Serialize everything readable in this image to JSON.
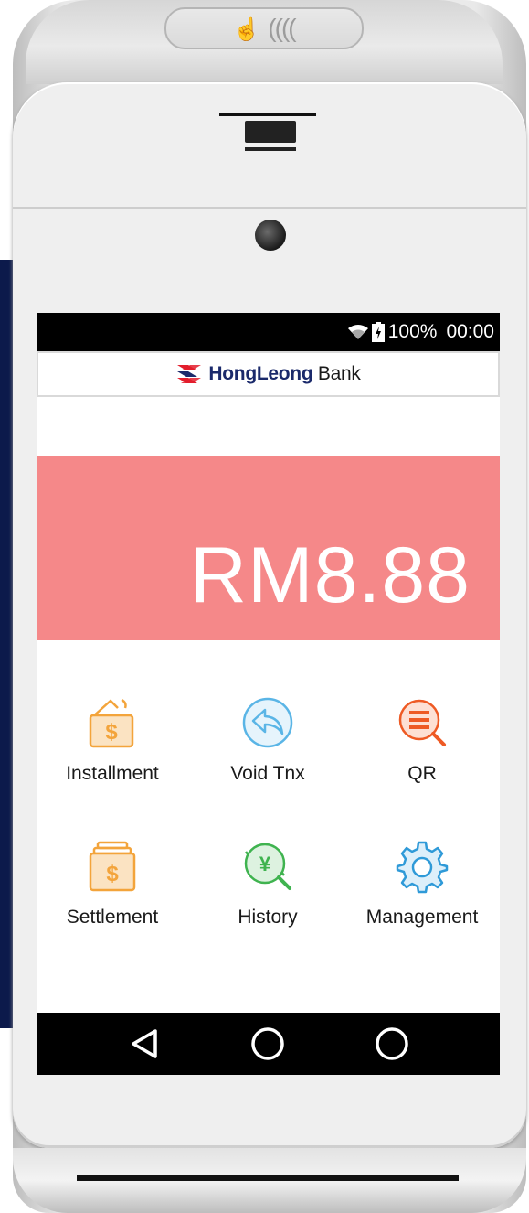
{
  "device": {
    "nfc_symbol": "((((",
    "icons": [
      "nfc-contactless-icon",
      "printer-slot",
      "front-camera"
    ]
  },
  "status_bar": {
    "battery": "100%",
    "time": "00:00",
    "icons": [
      "wifi-icon",
      "battery-icon"
    ]
  },
  "header": {
    "brand_bold": "HongLeong",
    "brand_regular": "Bank",
    "logo_color": "#e31d2c"
  },
  "payment": {
    "amount": "RM8.88",
    "panel_color": "#f58889"
  },
  "menu": {
    "items": [
      {
        "label": "Installment",
        "icon": "wallet-dollar-icon",
        "color": "#f3a43b"
      },
      {
        "label": "Void Tnx",
        "icon": "undo-arrow-icon",
        "color": "#5ab5e6"
      },
      {
        "label": "QR",
        "icon": "list-search-icon",
        "color": "#ee5a24"
      },
      {
        "label": "Settlement",
        "icon": "cash-stack-dollar-icon",
        "color": "#f3a43b"
      },
      {
        "label": "History",
        "icon": "yen-search-icon",
        "color": "#3fb34f"
      },
      {
        "label": "Management",
        "icon": "gear-icon",
        "color": "#2f9ad8"
      }
    ]
  },
  "nav_bar": {
    "buttons": [
      "back-icon",
      "home-icon",
      "recents-icon"
    ]
  }
}
